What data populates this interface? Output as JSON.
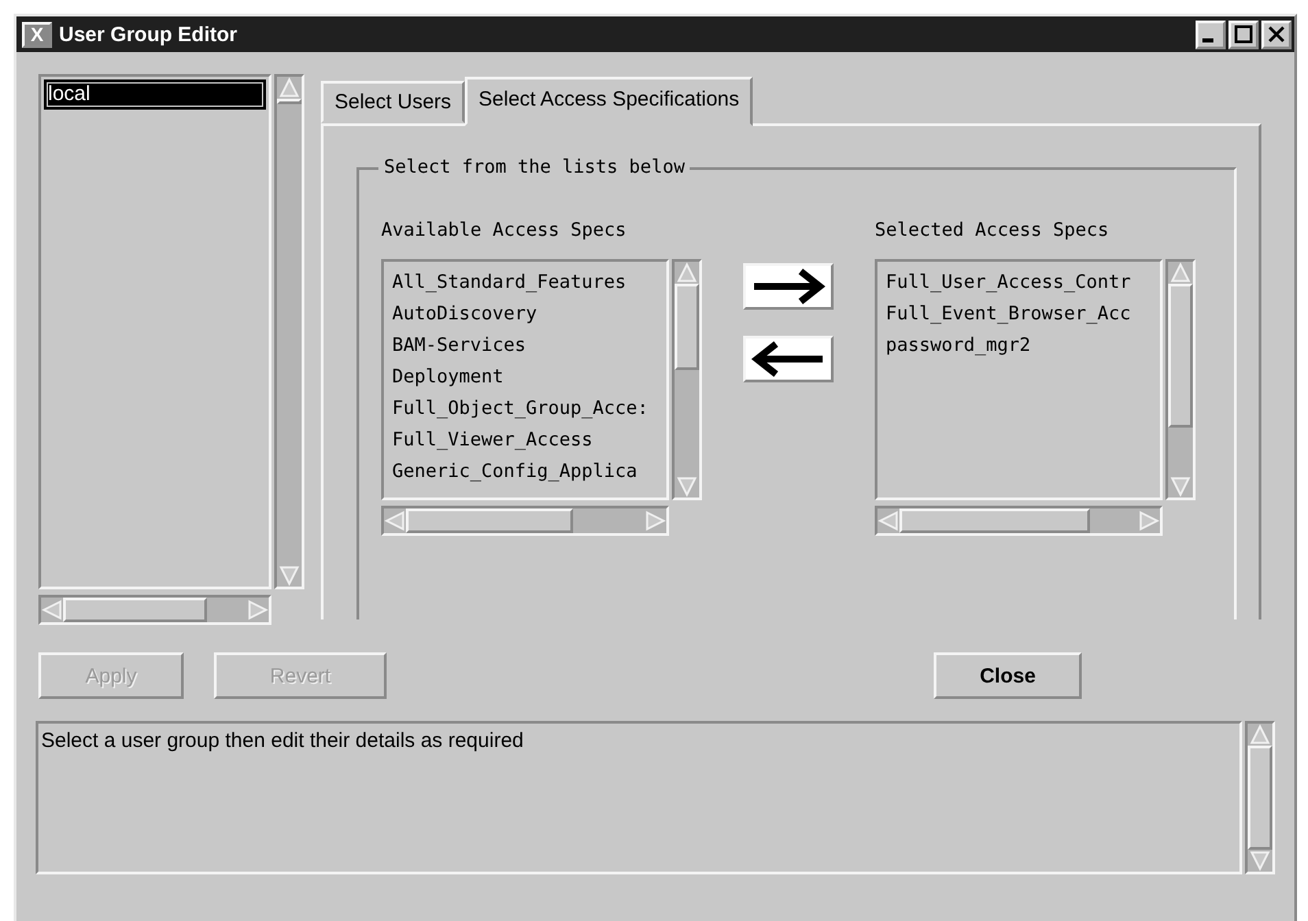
{
  "window": {
    "title": "User Group Editor",
    "icon": "X"
  },
  "groups": {
    "items": [
      {
        "label": "local",
        "selected": true
      }
    ]
  },
  "tabs": [
    {
      "label": "Select Users",
      "selected": false
    },
    {
      "label": "Select Access Specifications",
      "selected": true
    }
  ],
  "group_box": {
    "title": "Select from the lists below"
  },
  "available": {
    "label": "Available Access Specs",
    "items": [
      {
        "label": "All_Standard_Features",
        "selected": false
      },
      {
        "label": "AutoDiscovery",
        "selected": false
      },
      {
        "label": "BAM-Services",
        "selected": false
      },
      {
        "label": "Deployment",
        "selected": false
      },
      {
        "label": "Full_Object_Group_Acce:",
        "selected": false
      },
      {
        "label": "Full_Viewer_Access",
        "selected": false
      },
      {
        "label": "Generic_Config_Applica",
        "selected": false
      }
    ]
  },
  "selected_specs": {
    "label": "Selected Access Specs",
    "items": [
      {
        "label": "Full_User_Access_Contr",
        "selected": false
      },
      {
        "label": "Full_Event_Browser_Acc",
        "selected": false
      },
      {
        "label": "password_mgr2",
        "selected": false
      }
    ]
  },
  "buttons": [
    {
      "label": "Apply",
      "disabled": true
    },
    {
      "label": "Revert",
      "disabled": true
    },
    {
      "label": "Close",
      "disabled": false
    }
  ],
  "message": "Select a user group then edit their details as required"
}
